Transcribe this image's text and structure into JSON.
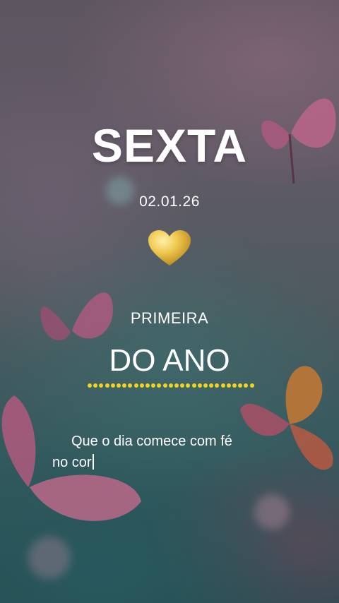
{
  "story": {
    "title": "SEXTA",
    "date": "02.01.26",
    "heart_emoji": "golden-heart",
    "subtitle_small": "PRIMEIRA",
    "subtitle_large": "DO ANO",
    "message_line1": "Que o dia comece com fé",
    "message_line2": "no cor"
  },
  "colors": {
    "accent_dots": "#f2d21e",
    "text": "#ffffff",
    "heart": "#e0b43a"
  }
}
